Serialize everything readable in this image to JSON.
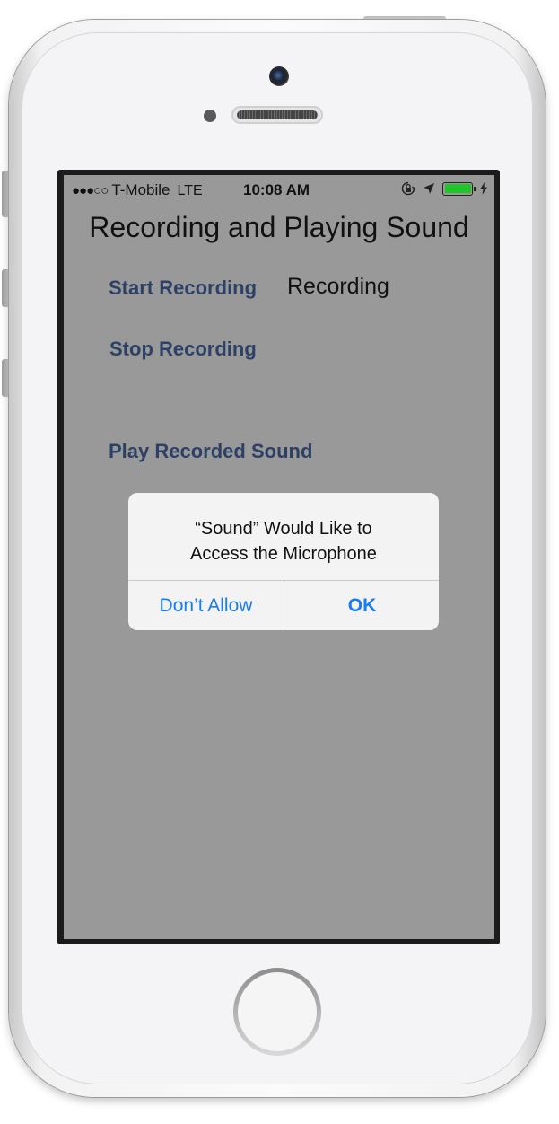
{
  "status_bar": {
    "signal": "●●●○○",
    "carrier": "T-Mobile",
    "network": "LTE",
    "time": "10:08 AM",
    "battery_color": "#1fc62a"
  },
  "app": {
    "title": "Recording and Playing Sound",
    "start_button": "Start Recording",
    "status_text": "Recording",
    "stop_button": "Stop Recording",
    "play_button": "Play Recorded Sound"
  },
  "alert": {
    "title_line1": "“Sound” Would Like to",
    "title_line2": "Access the Microphone",
    "deny_button": "Don’t Allow",
    "ok_button": "OK"
  },
  "colors": {
    "screen_background": "#999999",
    "button_text": "#2d4166",
    "alert_button": "#1a7cf0"
  }
}
